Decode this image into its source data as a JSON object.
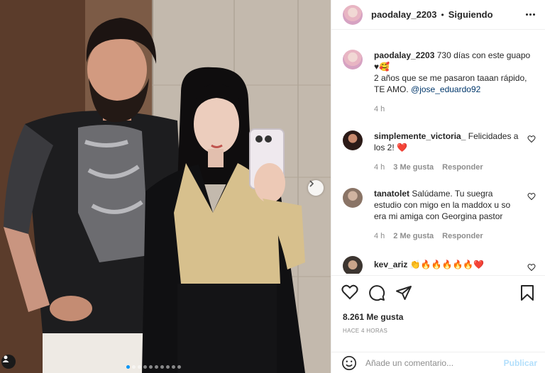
{
  "post": {
    "username": "paodalay_2203",
    "separator": "•",
    "follow_status": "Siguiendo",
    "caption_line1": "730 días con este guapo",
    "caption_emoji": "♥🥰",
    "caption_line2": "2 años que se me pasaron taaan rápido,",
    "caption_line3": "TE AMO.",
    "caption_mention": "@jose_eduardo92",
    "caption_time": "4 h",
    "likes": "8.261 Me gusta",
    "timestamp": "HACE 4 HORAS",
    "carousel": {
      "count": 10,
      "active_index": 0
    }
  },
  "comments": [
    {
      "username": "simplemente_victoria_",
      "text_line1": "Felicidades a",
      "text_line2": "los 2!",
      "emoji": "❤️",
      "time": "4 h",
      "likes": "3 Me gusta",
      "reply": "Responder"
    },
    {
      "username": "tanatolet",
      "text_line1": "Salúdame. Tu suegra",
      "text_line2": "estudio con migo en la maddox u so",
      "text_line3": "era mi amiga con Georgina pastor",
      "time": "4 h",
      "likes": "2 Me gusta",
      "reply": "Responder"
    },
    {
      "username": "kev_ariz",
      "emoji": "👏🔥🔥🔥🔥🔥❤️"
    }
  ],
  "add_comment": {
    "placeholder": "Añade un comentario...",
    "publish": "Publicar"
  },
  "colors": {
    "accent": "#0095f6",
    "publish_disabled": "#b2dffc",
    "mention": "#00376b",
    "secondary_text": "#8e8e8e",
    "heart_red": "#ed4956"
  },
  "icons": [
    "heart-icon",
    "comment-icon",
    "share-icon",
    "bookmark-icon",
    "more-icon",
    "emoji-icon",
    "chevron-right-icon",
    "tag-user-icon"
  ]
}
